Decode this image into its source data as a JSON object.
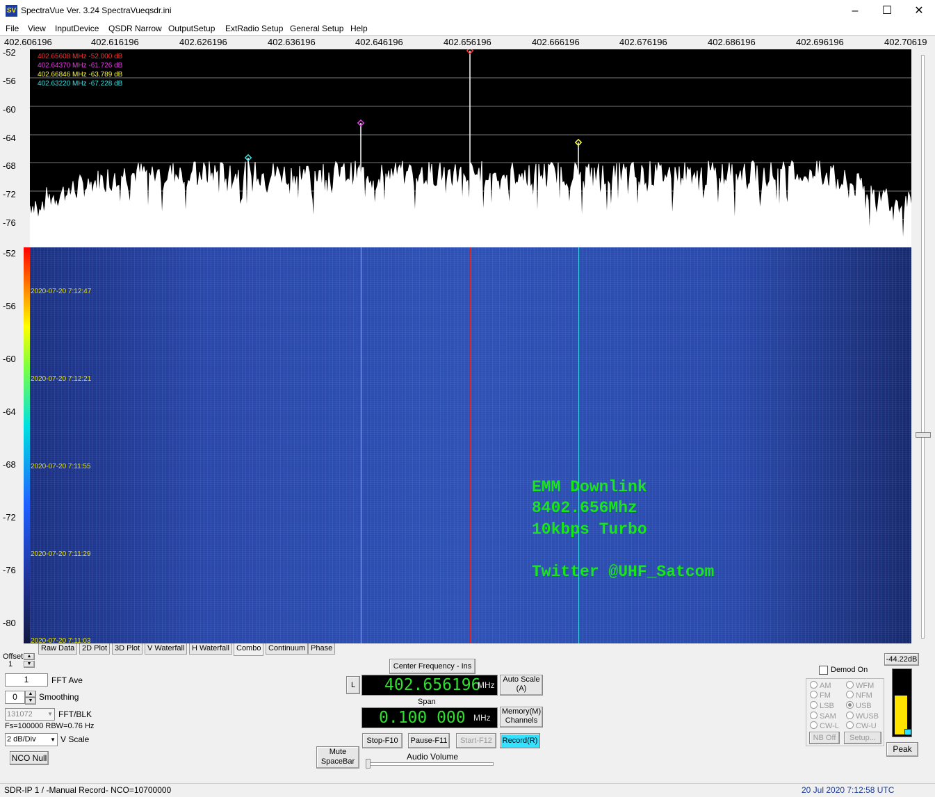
{
  "window": {
    "title": "SpectraVue Ver. 3.24  SpectraVueqsdr.ini",
    "icon_text": "SV"
  },
  "menu": [
    "File",
    "View",
    "InputDevice",
    "QSDR Narrow",
    "OutputSetup",
    "ExtRadio Setup",
    "General Setup",
    "Help"
  ],
  "freq_axis": [
    "402.606196",
    "402.616196",
    "402.626196",
    "402.636196",
    "402.646196",
    "402.656196",
    "402.666196",
    "402.676196",
    "402.686196",
    "402.696196",
    "402.70619"
  ],
  "spectrum_db_labels": [
    "-52",
    "-56",
    "-60",
    "-64",
    "-68",
    "-72",
    "-76"
  ],
  "waterfall_db_labels": [
    "-52",
    "-56",
    "-60",
    "-64",
    "-68",
    "-72",
    "-76",
    "-80"
  ],
  "markers": [
    {
      "text": "402.65608 MHz  -52.000  dB",
      "color": "#ff3030"
    },
    {
      "text": "402.64370  MHz  -61.726  dB",
      "color": "#e040e0"
    },
    {
      "text": "402.66846  MHz  -63.789  dB",
      "color": "#ffff40"
    },
    {
      "text": "402.63220  MHz  -67.228  dB",
      "color": "#40e0e0"
    }
  ],
  "timestamps": [
    "2020-07-20 7:12:47",
    "2020-07-20 7:12:21",
    "2020-07-20 7:11:55",
    "2020-07-20 7:11:29",
    "2020-07-20 7:11:03"
  ],
  "overlay": [
    "EMM Downlink",
    "8402.656Mhz",
    "10kbps Turbo",
    "",
    "Twitter @UHF_Satcom"
  ],
  "tabs": [
    "Raw Data",
    "2D Plot",
    "3D Plot",
    "V Waterfall",
    "H Waterfall",
    "Combo",
    "Continuum",
    "Phase"
  ],
  "controls": {
    "offset_label": "Offset",
    "offset_value": "1",
    "fft_ave_value": "1",
    "fft_ave_label": "FFT Ave",
    "smoothing_value": "0",
    "smoothing_label": "Smoothing",
    "fft_blk_value": "131072",
    "fft_blk_label": "FFT/BLK",
    "fs_text": "Fs=100000 RBW=0.76 Hz",
    "vscale_value": "2 dB/Div",
    "vscale_label": "V Scale",
    "nco_null": "NCO Null",
    "center_freq_btn": "Center Frequency - Ins",
    "l_btn": "L",
    "center_freq": "402.656196",
    "mhz": "MHz",
    "auto_scale": "Auto Scale",
    "auto_scale_key": "(A)",
    "span_label": "Span",
    "span_value": "0.100 000",
    "memory": "Memory(M)",
    "channels": "Channels",
    "stop": "Stop-F10",
    "pause": "Pause-F11",
    "start": "Start-F12",
    "record": "Record(R)",
    "mute": "Mute",
    "spacebar": "SpaceBar",
    "audio_volume": "Audio Volume",
    "demod_on": "Demod On",
    "modes_left": [
      "AM",
      "FM",
      "LSB",
      "SAM",
      "CW-L"
    ],
    "modes_right": [
      "WFM",
      "NFM",
      "USB",
      "WUSB",
      "CW-U"
    ],
    "nb_off": "NB Off",
    "setup": "Setup...",
    "level_readout": "-44.22dB",
    "peak": "Peak",
    "level_fraction": 0.62
  },
  "status": {
    "left": "SDR-IP 1  / -Manual Record-   NCO=10700000",
    "right": "20 Jul 2020  7:12:58 UTC"
  },
  "colors": {
    "spectrum_bg": "#000000",
    "lcd_text": "#2fe02f",
    "overlay_text": "#19e619",
    "record_bg": "#36e0ff"
  }
}
